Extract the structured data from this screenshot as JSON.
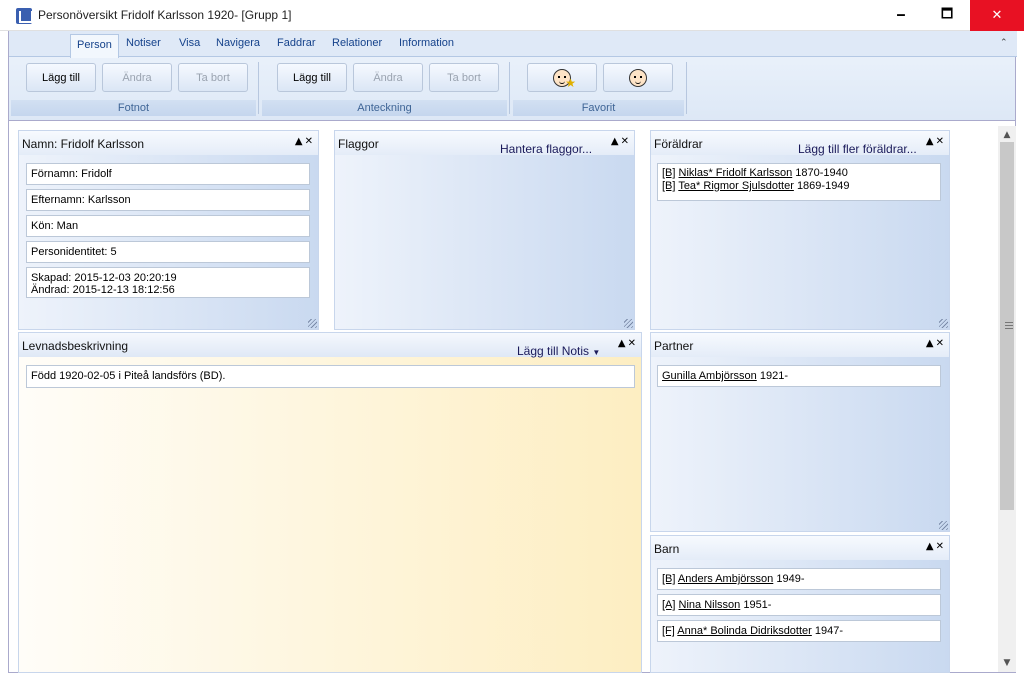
{
  "window": {
    "title": "Personöversikt Fridolf Karlsson 1920- [Grupp 1]",
    "minimize": "🗕",
    "maximize": "🗖",
    "close": "✕"
  },
  "ribbon": {
    "tabs": [
      "Person",
      "Notiser",
      "Visa",
      "Navigera",
      "Faddrar",
      "Relationer",
      "Information"
    ],
    "active_tab": "Person",
    "groups": {
      "fotnot": {
        "label": "Fotnot",
        "buttons": [
          "Lägg till",
          "Ändra",
          "Ta bort"
        ]
      },
      "anteckning": {
        "label": "Anteckning",
        "buttons": [
          "Lägg till",
          "Ändra",
          "Ta bort"
        ]
      },
      "favorit": {
        "label": "Favorit"
      }
    }
  },
  "panels": {
    "namn": {
      "title": "Namn: Fridolf Karlsson",
      "fields": [
        "Förnamn: Fridolf",
        "Efternamn: Karlsson",
        "Kön: Man",
        "Personidentitet: 5",
        "Skapad: 2015-12-03 20:20:19\nÄndrad: 2015-12-13 18:12:56"
      ]
    },
    "flaggor": {
      "title": "Flaggor",
      "link": "Hantera flaggor..."
    },
    "foraldrar": {
      "title": "Föräldrar",
      "link": "Lägg till fler föräldrar...",
      "rows": [
        {
          "tag": "[B]",
          "name": "Niklas* Fridolf Karlsson",
          "years": "1870-1940"
        },
        {
          "tag": "[B]",
          "name": "Tea* Rigmor Sjulsdotter",
          "years": "1869-1949"
        }
      ]
    },
    "levnad": {
      "title": "Levnadsbeskrivning",
      "link": "Lägg till Notis",
      "text": "Född 1920-02-05 i Piteå landsförs (BD)."
    },
    "partner": {
      "title": "Partner",
      "rows": [
        {
          "name": "Gunilla Ambjörsson",
          "years": "1921-"
        }
      ]
    },
    "barn": {
      "title": "Barn",
      "rows": [
        {
          "tag": "[B]",
          "name": "Anders Ambjörsson",
          "years": "1949-"
        },
        {
          "tag": "[A]",
          "name": "Nina Nilsson",
          "years": "1951-"
        },
        {
          "tag": "[F]",
          "name": "Anna* Bolinda Didriksdotter",
          "years": "1947-"
        }
      ]
    }
  }
}
